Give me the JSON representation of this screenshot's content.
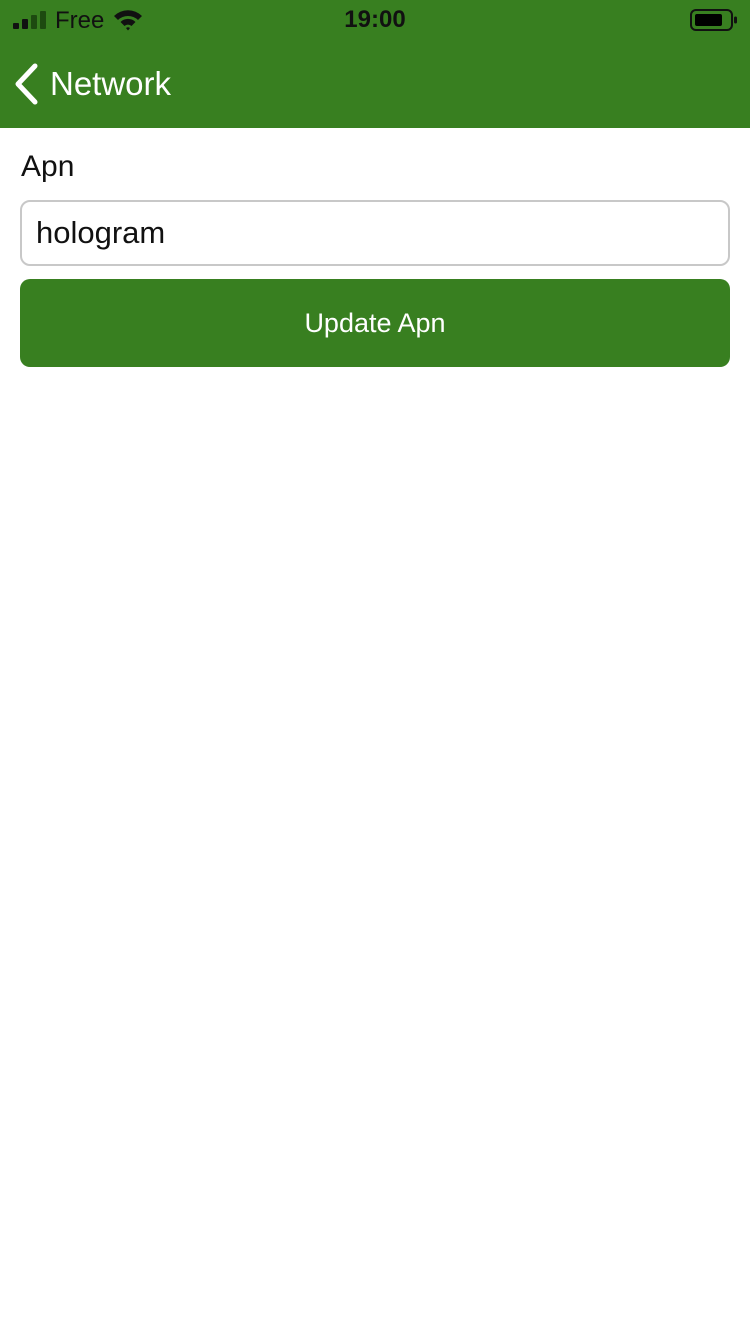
{
  "status_bar": {
    "carrier": "Free",
    "time": "19:00",
    "signal_icon": "cellular-signal-icon",
    "wifi_icon": "wifi-icon",
    "battery_icon": "battery-icon"
  },
  "nav": {
    "back_icon": "chevron-left-icon",
    "back_label": "Network"
  },
  "form": {
    "label": "Apn",
    "input_value": "hologram",
    "button_label": "Update Apn"
  },
  "colors": {
    "accent": "#387f20",
    "background": "#ffffff",
    "text": "#111111",
    "input_border": "#c8c8c8"
  }
}
